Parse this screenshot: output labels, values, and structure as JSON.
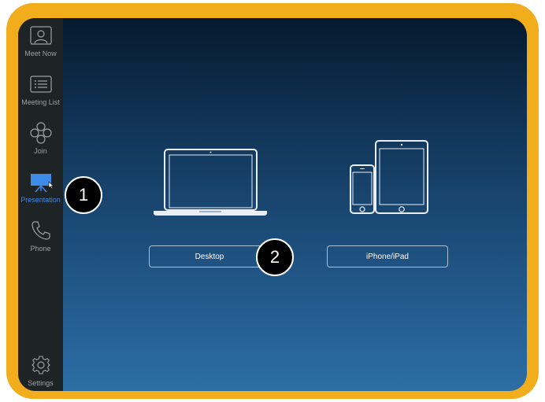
{
  "sidebar": {
    "items": [
      {
        "label": "Meet Now",
        "icon": "meet-now-icon"
      },
      {
        "label": "Meeting List",
        "icon": "meeting-list-icon"
      },
      {
        "label": "Join",
        "icon": "join-icon"
      },
      {
        "label": "Presentation",
        "icon": "presentation-icon",
        "active": true
      },
      {
        "label": "Phone",
        "icon": "phone-icon"
      },
      {
        "label": "Settings",
        "icon": "gear-icon"
      }
    ]
  },
  "main": {
    "options": [
      {
        "label": "Desktop",
        "icon": "laptop-icon"
      },
      {
        "label": "iPhone/iPad",
        "icon": "iphone-ipad-icon"
      }
    ]
  },
  "markers": [
    "1",
    "2"
  ],
  "colors": {
    "frame": "#f2ad1d",
    "sidebar": "#1e2326",
    "active": "#3d8be6",
    "inactive": "#9aa0a4"
  }
}
